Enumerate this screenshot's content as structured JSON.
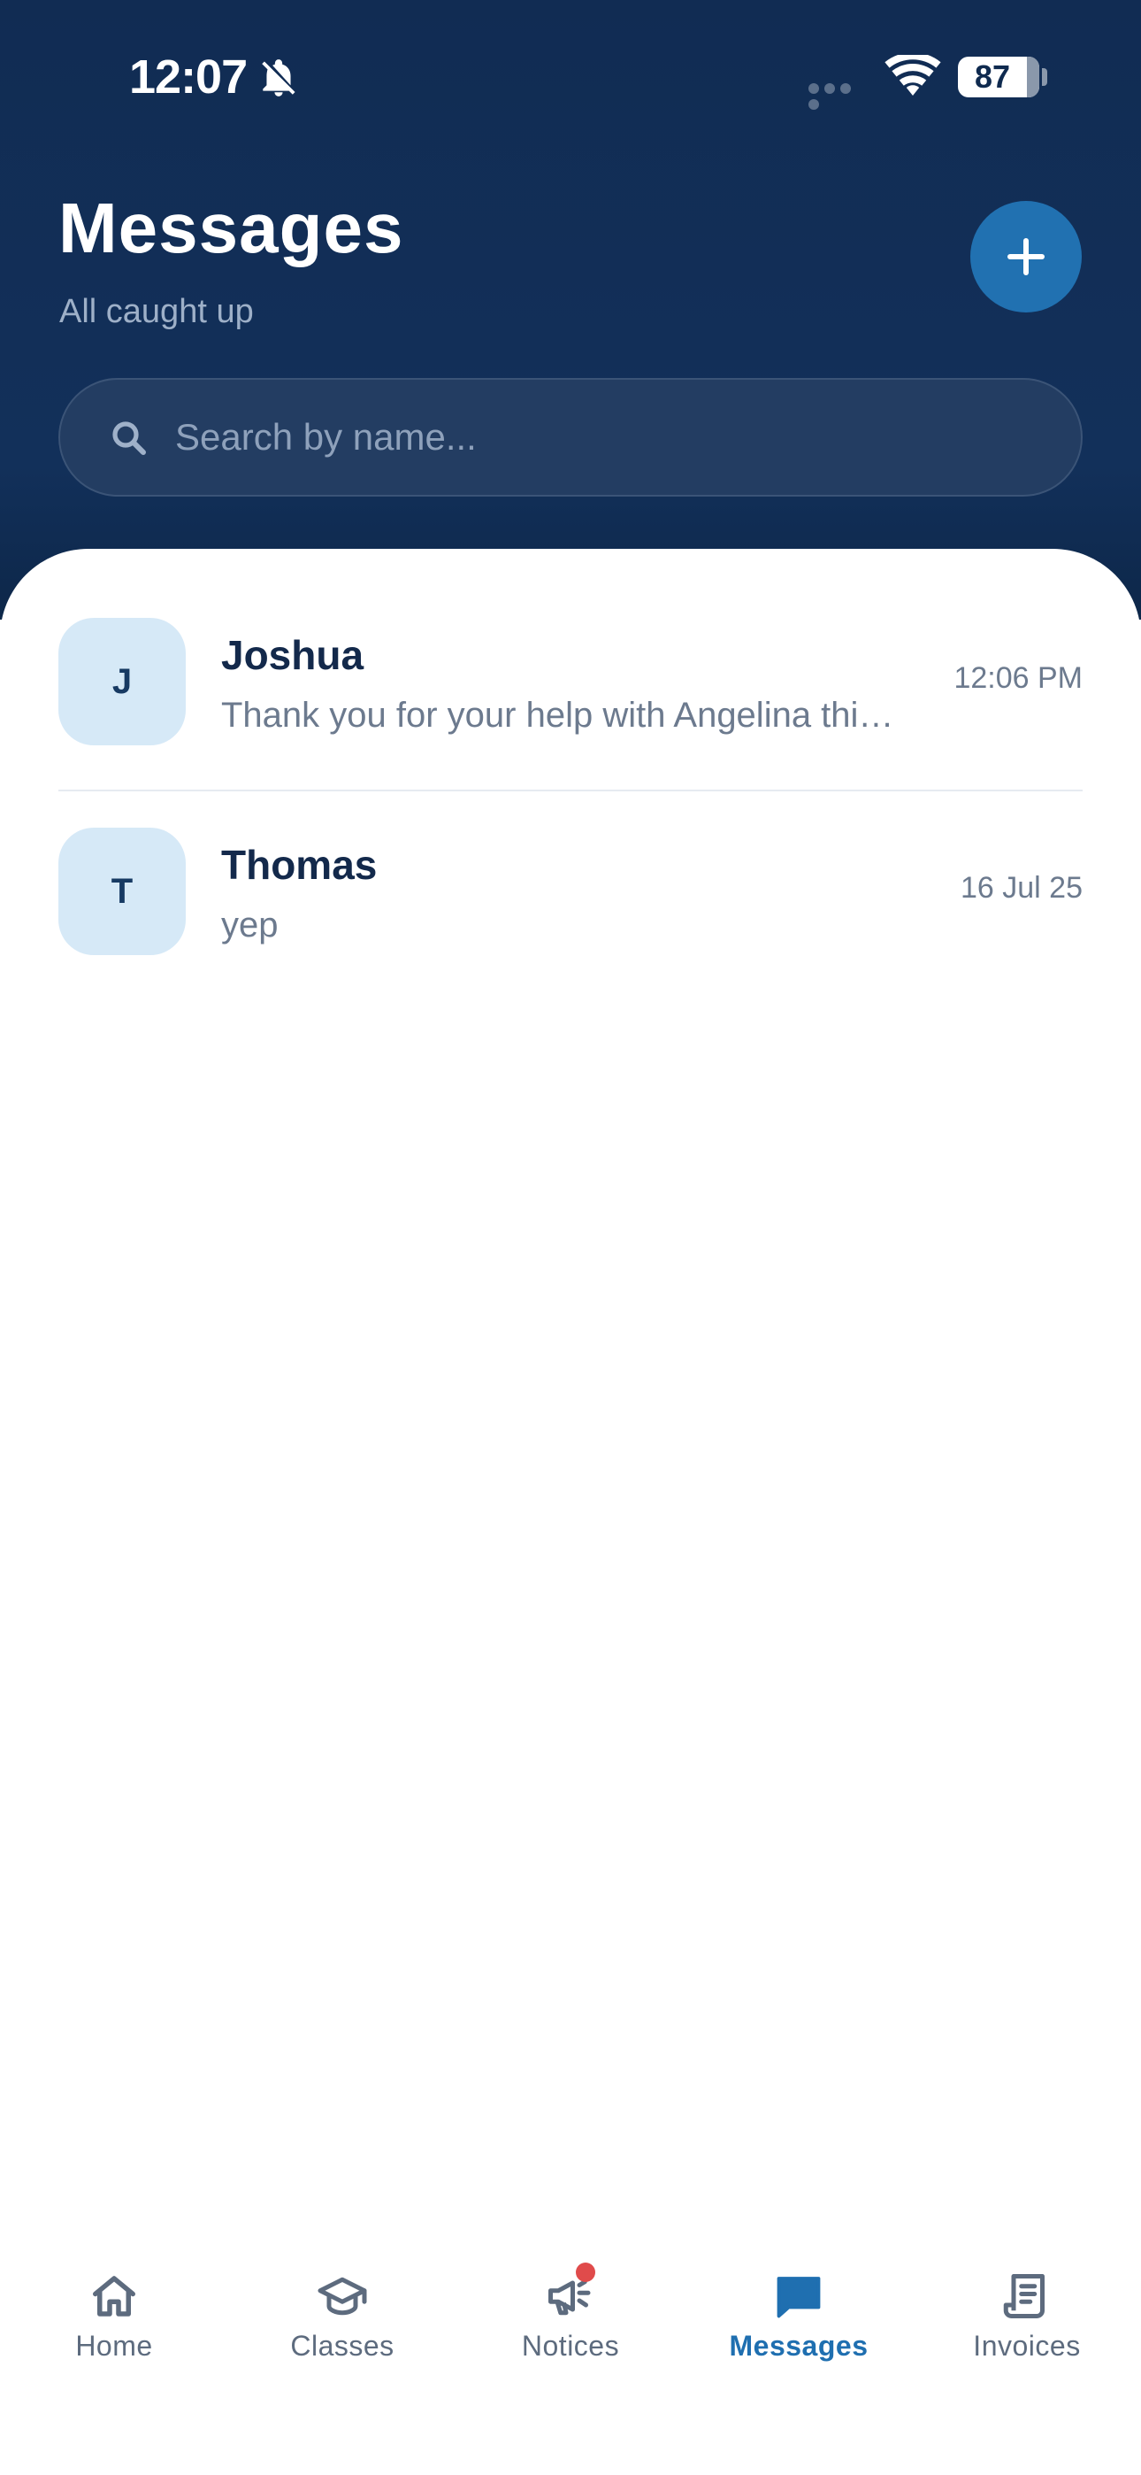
{
  "status_bar": {
    "time": "12:07",
    "battery": "87",
    "icons": [
      "bell-slash-icon",
      "cellular-icon",
      "wifi-icon",
      "battery-icon"
    ]
  },
  "header": {
    "title": "Messages",
    "subtitle": "All caught up",
    "new_button_icon": "plus-icon"
  },
  "search": {
    "placeholder": "Search by name..."
  },
  "threads": [
    {
      "initial": "J",
      "name": "Joshua",
      "preview": "Thank you for your help with Angelina thi…",
      "time": "12:06 PM"
    },
    {
      "initial": "T",
      "name": "Thomas",
      "preview": "yep",
      "time": "16 Jul 25"
    }
  ],
  "nav": {
    "items": [
      {
        "label": "Home",
        "icon": "home-icon",
        "active": false
      },
      {
        "label": "Classes",
        "icon": "graduation-cap-icon",
        "active": false
      },
      {
        "label": "Notices",
        "icon": "megaphone-icon",
        "active": false,
        "badge": true
      },
      {
        "label": "Messages",
        "icon": "chat-bubble-icon",
        "active": true
      },
      {
        "label": "Invoices",
        "icon": "receipt-icon",
        "active": false
      }
    ]
  },
  "colors": {
    "header_bg": "#112c53",
    "accent": "#2171b1",
    "avatar_bg": "#d6e9f7",
    "badge": "#e04b4b"
  }
}
